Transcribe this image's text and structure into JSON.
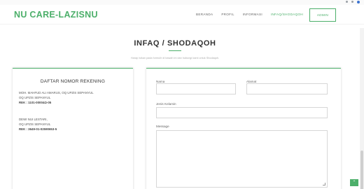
{
  "header": {
    "brand": "NU CARE-LAZISNU",
    "nav": [
      {
        "label": "BERANDA"
      },
      {
        "label": "PROFIL"
      },
      {
        "label": "INFORMASI"
      },
      {
        "label": "INFAQ/SHODAQOH"
      }
    ],
    "admin_label": "ADMIN"
  },
  "section": {
    "title": "INFAQ / SHODAQOH",
    "subtitle": "Harap isikan pada formulir di bawah ini dan hubungi kami untuk Shodaqoh."
  },
  "accounts": {
    "title": "DAFTAR NOMOR REKENING",
    "items": [
      {
        "name": "MOH. MAHFUD ALI AMARUS, OQ UPZIS SEPANYUL",
        "bank": "OQ UPZIS SEPANYUL",
        "rek": "REK : 1101-00004Ω-05"
      },
      {
        "name": "DEWI NUI LESTARI,",
        "bank": "OQ UPZIS SEPANYUL",
        "rek": "REK : 3649-01-02590653-5"
      }
    ]
  },
  "form": {
    "nama_label": "Nama",
    "alamat_label": "Alamat",
    "jenis_label": "Jenis Kelamin",
    "message_label": "Message"
  },
  "icons": {
    "to_top": "chevron-up-icon"
  },
  "colors": {
    "accent": "#4caf6a"
  }
}
